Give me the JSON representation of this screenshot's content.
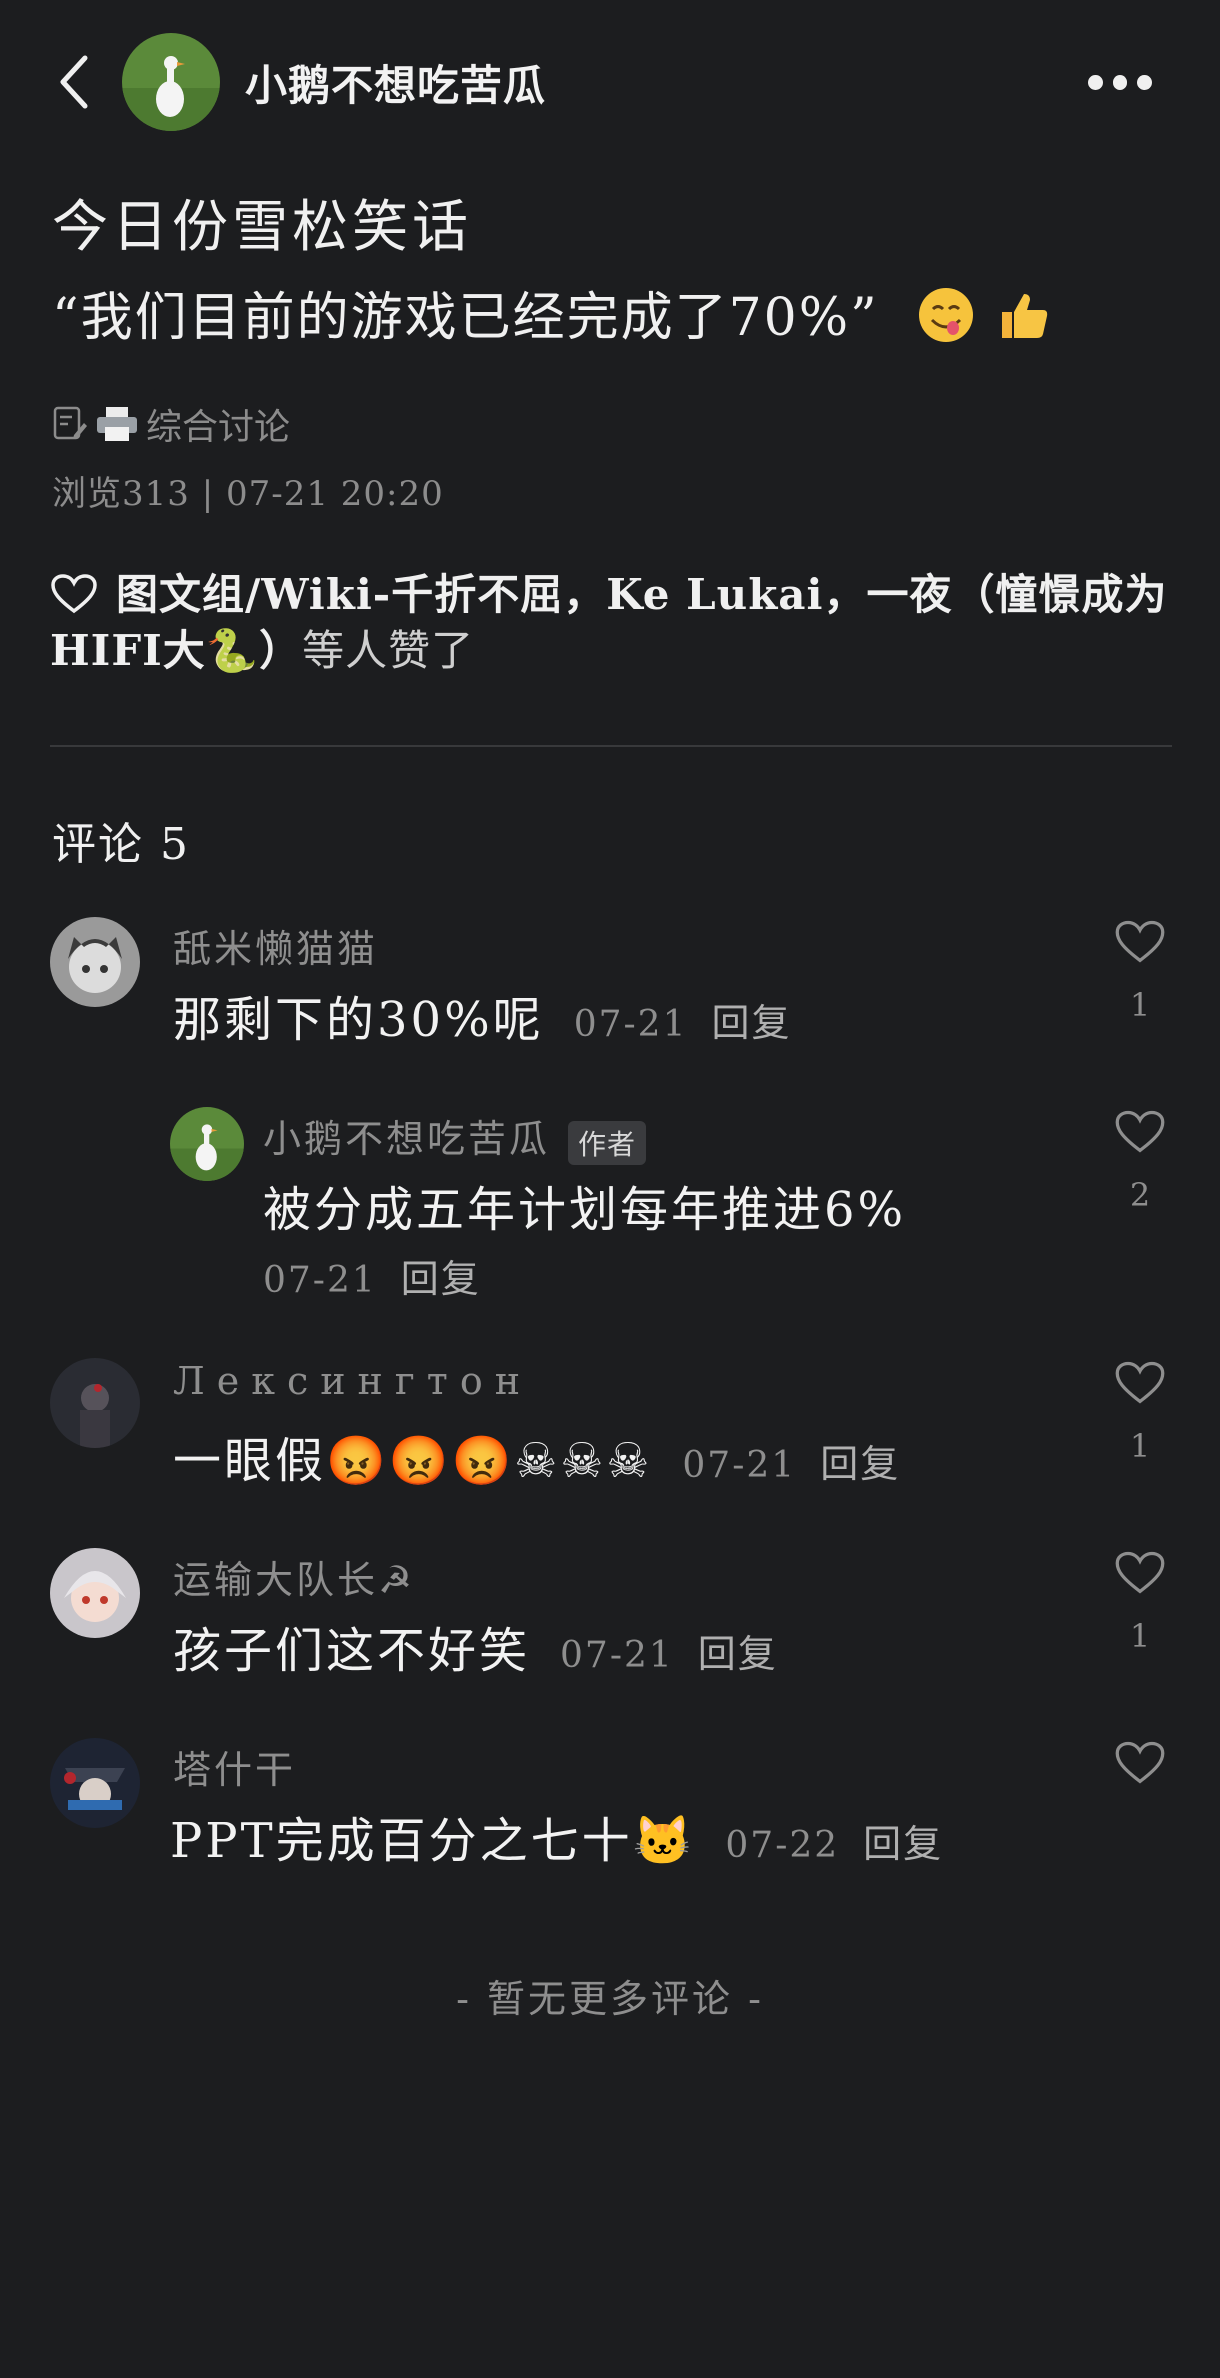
{
  "header": {
    "author_name": "小鹅不想吃苦瓜",
    "back_icon": "chevron-left-icon",
    "more_icon": "more-dots-icon"
  },
  "post": {
    "title_line1": "今日份雪松笑话",
    "title_line2": "“我们目前的游戏已经完成了70%”",
    "title_emojis": [
      "😋",
      "👍"
    ],
    "category": "综合讨论",
    "category_icons": [
      "document-edit-icon",
      "printer-icon"
    ],
    "meta": "浏览313 | 07-21 20:20",
    "likes_names": "图文组/Wiki-千折不屈，Ke Lukai，一夜（憧憬成为HIFI大🐍）",
    "likes_tail": "等人赞了"
  },
  "comments_section": {
    "title": "评论 5",
    "comments": [
      {
        "name": "舐米懒猫猫",
        "text": "那剩下的30%呢",
        "date": "07-21",
        "reply": "回复",
        "likes": "1"
      },
      {
        "name": "小鹅不想吃苦瓜",
        "badge": "作者",
        "text": "被分成五年计划每年推进6%",
        "date": "07-21",
        "reply": "回复",
        "likes": "2"
      },
      {
        "name": "Лексингтон",
        "text": "一眼假😡😡😡☠☠☠",
        "date": "07-21",
        "reply": "回复",
        "likes": "1"
      },
      {
        "name": "运输大队长☭",
        "text": "孩子们这不好笑",
        "date": "07-21",
        "reply": "回复",
        "likes": "1"
      },
      {
        "name": "塔什干",
        "text": "PPT完成百分之七十🐱",
        "date": "07-22",
        "reply": "回复",
        "likes": ""
      }
    ],
    "no_more": "- 暂无更多评论 -"
  },
  "colors": {
    "background": "#1c1d1f",
    "text_primary": "#f0f0f0",
    "text_secondary": "#8e8e8e",
    "divider": "#38393b"
  }
}
